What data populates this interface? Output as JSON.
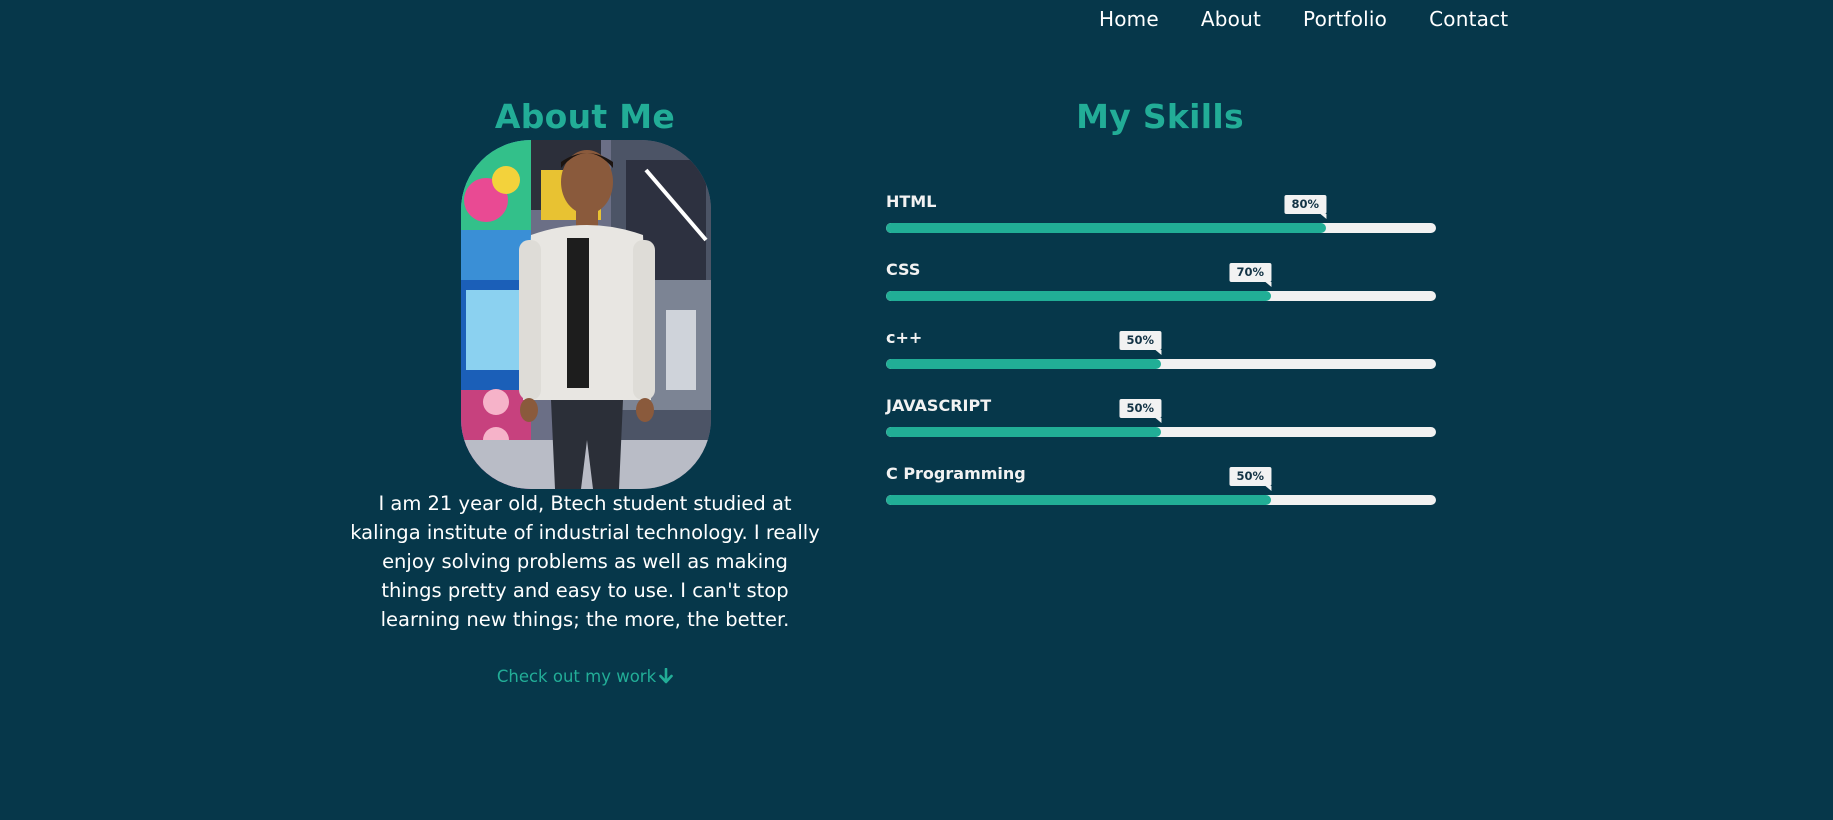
{
  "nav": {
    "items": [
      {
        "label": "Home"
      },
      {
        "label": "About"
      },
      {
        "label": "Portfolio"
      },
      {
        "label": "Contact"
      }
    ]
  },
  "about": {
    "title": "About Me",
    "photo_alt": "Portrait photo",
    "text": "I am 21 year old, Btech student studied at kalinga institute of industrial technology. I really enjoy solving problems as well as making things pretty and easy to use. I can't stop learning new things; the more, the better.",
    "cta_label": "Check out my work",
    "cta_icon": "arrow-down-icon"
  },
  "skills": {
    "title": "My Skills",
    "items": [
      {
        "name": "HTML",
        "badge": "80%",
        "level": 0.8
      },
      {
        "name": "CSS",
        "badge": "70%",
        "level": 0.7
      },
      {
        "name": "c++",
        "badge": "50%",
        "level": 0.5
      },
      {
        "name": "JAVASCRIPT",
        "badge": "50%",
        "level": 0.5
      },
      {
        "name": "C Programming",
        "badge": "50%",
        "level": 0.7
      }
    ]
  },
  "colors": {
    "background": "#06374a",
    "accent": "#22ad97",
    "track": "#f1f1f1"
  }
}
